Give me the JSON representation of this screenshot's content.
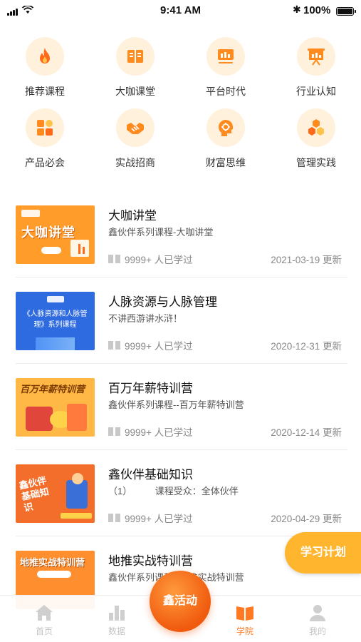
{
  "status_bar": {
    "time": "9:41 AM",
    "battery": "100%"
  },
  "categories": [
    {
      "label": "推荐课程",
      "icon": "fire-icon"
    },
    {
      "label": "大咖课堂",
      "icon": "book-icon"
    },
    {
      "label": "平台时代",
      "icon": "monitor-icon"
    },
    {
      "label": "行业认知",
      "icon": "presentation-icon"
    },
    {
      "label": "产品必会",
      "icon": "grid-icon"
    },
    {
      "label": "实战招商",
      "icon": "handshake-icon"
    },
    {
      "label": "财富思维",
      "icon": "head-idea-icon"
    },
    {
      "label": "管理实践",
      "icon": "hexagon-icon"
    }
  ],
  "courses": [
    {
      "title": "大咖讲堂",
      "subtitle": "鑫伙伴系列课程-大咖讲堂",
      "learners": "9999+ 人已学过",
      "updated": "2021-03-19 更新",
      "thumb_text": "大咖讲堂"
    },
    {
      "title": "人脉资源与人脉管理",
      "subtitle": "不讲西游讲水浒！",
      "learners": "9999+ 人已学过",
      "updated": "2020-12-31 更新",
      "thumb_text": "《人脉资源和人脉管理》系列课程"
    },
    {
      "title": "百万年薪特训营",
      "subtitle": "鑫伙伴系列课程--百万年薪特训营",
      "learners": "9999+ 人已学过",
      "updated": "2020-12-14 更新",
      "thumb_text": "百万年薪特训营"
    },
    {
      "title": "鑫伙伴基础知识",
      "subtitle": "（1）　　　课程受众：全体伙伴",
      "learners": "9999+ 人已学过",
      "updated": "2020-04-29 更新",
      "thumb_text": "鑫伙伴基础知识"
    },
    {
      "title": "地推实战特训营",
      "subtitle": "鑫伙伴系列课程--地推实战特训营",
      "learners": "",
      "updated": "",
      "thumb_text": "地推实战特训营"
    }
  ],
  "plan_button": "学习计划",
  "tabs": {
    "home": "首页",
    "data": "数据",
    "center": "鑫活动",
    "academy": "学院",
    "mine": "我的"
  },
  "colors": {
    "accent": "#ff7a22",
    "icon_bg": "#fff1dc",
    "plan": "#ffb52e"
  }
}
